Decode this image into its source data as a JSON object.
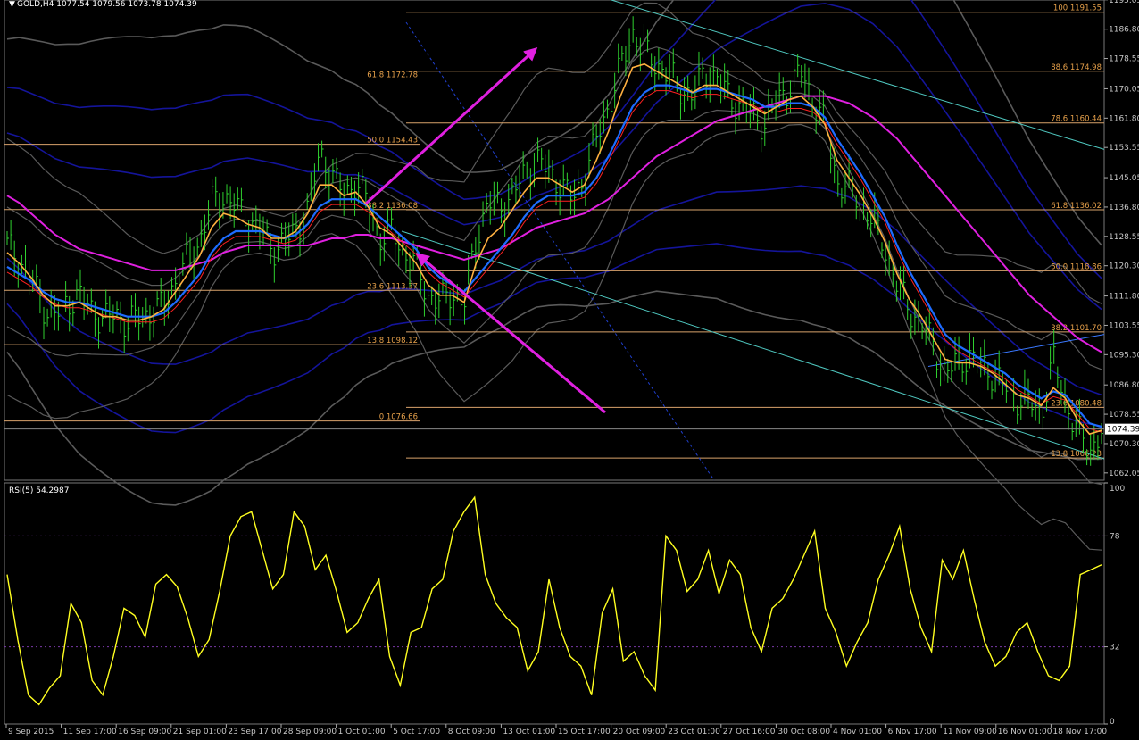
{
  "header": {
    "symbol_line": "GOLD,H4  1077.54 1079.56 1073.78 1074.39"
  },
  "colors": {
    "background": "#000000",
    "bull_bar": "#2fd12f",
    "fib_line": "#d9a36b",
    "fib_text": "#e6a04a",
    "ma_magenta": "#e020e0",
    "ma_blue": "#1e6cff",
    "ma_orange": "#ffb040",
    "ma_red": "#ff2020",
    "band_navy": "#14149a",
    "band_grey": "#5a5a5a",
    "channel": "#4fc8c0",
    "rsi_line": "#ffff20",
    "axis_text": "#c8c8c8",
    "arrow": "#e020e0"
  },
  "chart_data": [
    {
      "type": "line",
      "title": "GOLD,H4",
      "header_values": [
        "1077.54",
        "1079.56",
        "1073.78",
        "1074.39"
      ],
      "current_price": 1074.39,
      "current_price_label": "1074.39",
      "ylim": [
        1060,
        1195
      ],
      "y_ticks": [
        1195.05,
        1186.8,
        1178.55,
        1170.05,
        1161.8,
        1153.55,
        1145.05,
        1136.8,
        1128.55,
        1120.3,
        1111.8,
        1103.55,
        1095.3,
        1086.8,
        1078.55,
        1070.3,
        1062.05
      ],
      "y_tick_labels": [
        "1195.05",
        "1186.80",
        "1178.55",
        "1170.05",
        "1161.80",
        "1153.55",
        "1145.05",
        "1136.80",
        "1128.55",
        "1120.30",
        "1111.80",
        "1103.55",
        "1095.30",
        "1086.80",
        "1078.55",
        "1070.30",
        "1062.05"
      ],
      "x_tick_labels": [
        "9 Sep 2015",
        "11 Sep 17:00",
        "16 Sep 09:00",
        "21 Sep 01:00",
        "23 Sep 17:00",
        "28 Sep 09:00",
        "1 Oct 01:00",
        "5 Oct 17:00",
        "8 Oct 09:00",
        "13 Oct 01:00",
        "15 Oct 17:00",
        "20 Oct 09:00",
        "23 Oct 01:00",
        "27 Oct 16:00",
        "30 Oct 08:00",
        "4 Nov 01:00",
        "6 Nov 17:00",
        "11 Nov 09:00",
        "16 Nov 01:00",
        "18 Nov 17:00"
      ],
      "fib_left": {
        "levels": [
          {
            "label": "61.8 1172.78",
            "price": 1172.78
          },
          {
            "label": "50.0 1154.43",
            "price": 1154.43
          },
          {
            "label": "38.2 1136.08",
            "price": 1136.08
          },
          {
            "label": "23.6 1113.37",
            "price": 1113.37
          },
          {
            "label": "13.8 1098.12",
            "price": 1098.12
          },
          {
            "label": "0 1076.66",
            "price": 1076.66
          }
        ]
      },
      "fib_right": {
        "levels": [
          {
            "label": "100 1191.55",
            "price": 1191.55
          },
          {
            "label": "88.6 1174.98",
            "price": 1174.98
          },
          {
            "label": "78.6 1160.44",
            "price": 1160.44
          },
          {
            "label": "61.8 1136.02",
            "price": 1136.02
          },
          {
            "label": "50.0 1118.86",
            "price": 1118.86
          },
          {
            "label": "38.2 1101.70",
            "price": 1101.7
          },
          {
            "label": "23.6 1080.48",
            "price": 1080.48
          },
          {
            "label": "13.8 1066.23",
            "price": 1066.23
          }
        ]
      },
      "price_series": [
        1126,
        1122,
        1117,
        1109,
        1106,
        1110,
        1112,
        1108,
        1105,
        1107,
        1104,
        1106,
        1107,
        1109,
        1116,
        1122,
        1127,
        1138,
        1140,
        1137,
        1133,
        1131,
        1125,
        1127,
        1130,
        1136,
        1152,
        1146,
        1140,
        1144,
        1138,
        1128,
        1130,
        1124,
        1120,
        1112,
        1110,
        1113,
        1109,
        1128,
        1138,
        1137,
        1140,
        1146,
        1150,
        1147,
        1143,
        1139,
        1145,
        1156,
        1165,
        1176,
        1186,
        1180,
        1177,
        1174,
        1170,
        1168,
        1175,
        1173,
        1168,
        1165,
        1163,
        1160,
        1167,
        1170,
        1175,
        1167,
        1160,
        1144,
        1142,
        1138,
        1133,
        1125,
        1115,
        1108,
        1104,
        1098,
        1090,
        1093,
        1095,
        1092,
        1090,
        1086,
        1083,
        1082,
        1079,
        1094,
        1082,
        1074,
        1068,
        1074
      ],
      "ma_fast_series": [
        1124,
        1121,
        1117,
        1112,
        1109,
        1109,
        1110,
        1108,
        1106,
        1106,
        1105,
        1105,
        1106,
        1108,
        1113,
        1118,
        1123,
        1131,
        1135,
        1134,
        1132,
        1131,
        1128,
        1128,
        1130,
        1135,
        1143,
        1143,
        1140,
        1141,
        1137,
        1131,
        1129,
        1125,
        1121,
        1115,
        1112,
        1112,
        1110,
        1121,
        1128,
        1131,
        1136,
        1141,
        1145,
        1145,
        1143,
        1141,
        1143,
        1150,
        1158,
        1168,
        1176,
        1177,
        1175,
        1173,
        1171,
        1169,
        1171,
        1171,
        1169,
        1167,
        1165,
        1163,
        1165,
        1167,
        1168,
        1165,
        1160,
        1150,
        1145,
        1140,
        1134,
        1127,
        1118,
        1111,
        1106,
        1100,
        1094,
        1093,
        1093,
        1092,
        1090,
        1087,
        1084,
        1083,
        1081,
        1086,
        1083,
        1077,
        1073,
        1074
      ],
      "ma_mid_series": [
        1120,
        1118,
        1116,
        1113,
        1111,
        1110,
        1110,
        1109,
        1108,
        1107,
        1106,
        1106,
        1106,
        1107,
        1110,
        1114,
        1118,
        1124,
        1128,
        1130,
        1130,
        1130,
        1129,
        1128,
        1129,
        1132,
        1137,
        1139,
        1139,
        1139,
        1137,
        1134,
        1131,
        1128,
        1125,
        1120,
        1117,
        1115,
        1113,
        1117,
        1121,
        1125,
        1129,
        1134,
        1138,
        1140,
        1140,
        1140,
        1141,
        1145,
        1151,
        1158,
        1165,
        1169,
        1171,
        1171,
        1170,
        1169,
        1170,
        1170,
        1169,
        1168,
        1167,
        1165,
        1165,
        1166,
        1166,
        1165,
        1162,
        1156,
        1151,
        1146,
        1140,
        1134,
        1126,
        1119,
        1113,
        1107,
        1101,
        1098,
        1096,
        1094,
        1092,
        1090,
        1087,
        1085,
        1083,
        1085,
        1084,
        1080,
        1076,
        1075
      ],
      "ma_slow_series": [
        1140,
        1138,
        1135,
        1132,
        1129,
        1127,
        1125,
        1124,
        1123,
        1122,
        1121,
        1120,
        1119,
        1119,
        1119,
        1120,
        1121,
        1122,
        1124,
        1125,
        1126,
        1126,
        1126,
        1126,
        1126,
        1126,
        1127,
        1128,
        1128,
        1129,
        1129,
        1128,
        1128,
        1127,
        1126,
        1125,
        1124,
        1123,
        1122,
        1123,
        1124,
        1125,
        1127,
        1129,
        1131,
        1132,
        1133,
        1134,
        1135,
        1137,
        1139,
        1142,
        1145,
        1148,
        1151,
        1153,
        1155,
        1157,
        1159,
        1161,
        1162,
        1163,
        1164,
        1165,
        1166,
        1167,
        1168,
        1168,
        1168,
        1167,
        1166,
        1164,
        1162,
        1159,
        1156,
        1152,
        1148,
        1144,
        1140,
        1136,
        1132,
        1128,
        1124,
        1120,
        1116,
        1112,
        1109,
        1106,
        1103,
        1100,
        1098,
        1096
      ]
    },
    {
      "type": "line",
      "title": "RSI(5) 54.2987",
      "ylim": [
        0,
        100
      ],
      "y_ticks": [
        100,
        78,
        32,
        0
      ],
      "y_tick_labels": [
        "100",
        "78",
        "32",
        "0"
      ],
      "levels": [
        78,
        32
      ],
      "series": [
        {
          "values": [
            62,
            35,
            12,
            8,
            15,
            20,
            50,
            42,
            18,
            12,
            28,
            48,
            45,
            36,
            58,
            62,
            57,
            44,
            28,
            35,
            55,
            78,
            86,
            88,
            72,
            56,
            62,
            88,
            82,
            64,
            70,
            55,
            38,
            42,
            52,
            60,
            28,
            16,
            38,
            40,
            56,
            60,
            80,
            88,
            94,
            62,
            50,
            44,
            40,
            22,
            30,
            60,
            40,
            28,
            24,
            12,
            46,
            56,
            26,
            30,
            20,
            14,
            78,
            72,
            55,
            60,
            72,
            54,
            68,
            62,
            40,
            30,
            48,
            52,
            60,
            70,
            80,
            48,
            38,
            24,
            34,
            42,
            60,
            70,
            82,
            56,
            40,
            30,
            68,
            60,
            72,
            52,
            34,
            24,
            28,
            38,
            42,
            30,
            20,
            18,
            24,
            62,
            64,
            66
          ]
        }
      ]
    }
  ]
}
